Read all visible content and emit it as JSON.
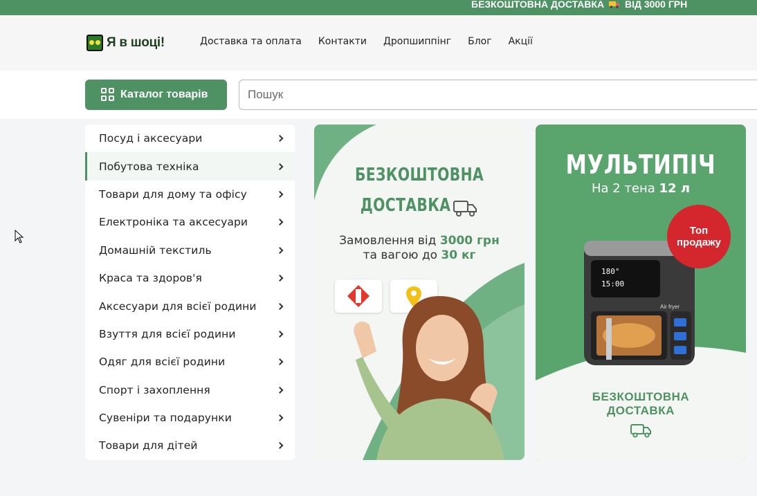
{
  "topbar": {
    "promo_text_1": "БЕЗКОШТОВНА ДОСТАВКА",
    "promo_text_2": "ВІД 3000 ГРН"
  },
  "header": {
    "logo_text": "Я в шоці!",
    "nav": [
      "Доставка та оплата",
      "Контакти",
      "Дропшиппінг",
      "Блог",
      "Акції"
    ]
  },
  "search": {
    "catalog_label": "Каталог товарів",
    "placeholder": "Пошук"
  },
  "sidebar": {
    "items": [
      {
        "label": "Посуд і аксесуари"
      },
      {
        "label": "Побутова техніка"
      },
      {
        "label": "Товари для дому та офісу"
      },
      {
        "label": "Електроніка та аксесуари"
      },
      {
        "label": "Домашній текстиль"
      },
      {
        "label": "Краса та здоров'я"
      },
      {
        "label": "Аксесуари для всієї родини"
      },
      {
        "label": "Взуття для всієї родини"
      },
      {
        "label": "Одяг для всієї родини"
      },
      {
        "label": "Спорт і захоплення"
      },
      {
        "label": "Сувеніри та подарунки"
      },
      {
        "label": "Товари для дітей"
      }
    ],
    "active_index": 1
  },
  "banner_delivery": {
    "title_line1": "БЕЗКОШТОВНА",
    "title_line2": "ДОСТАВКА",
    "sub_line1_pre": "Замовлення від ",
    "sub_line1_val": "3000 грн",
    "sub_line2_pre": "та вагою до ",
    "sub_line2_val": "30 кг"
  },
  "banner_product": {
    "title": "МУЛЬТИПІЧ",
    "sub_pre": "На 2 тена ",
    "sub_val": "12 л",
    "badge_line1": "Топ",
    "badge_line2": "продажу",
    "footer_line1": "БЕЗКОШТОВНА",
    "footer_line2": "ДОСТАВКА",
    "device_label": "Air fryer",
    "display_1": "180°",
    "display_2": "15:00"
  },
  "colors": {
    "brand_green": "#4e9163",
    "badge_red": "#d3262d"
  }
}
